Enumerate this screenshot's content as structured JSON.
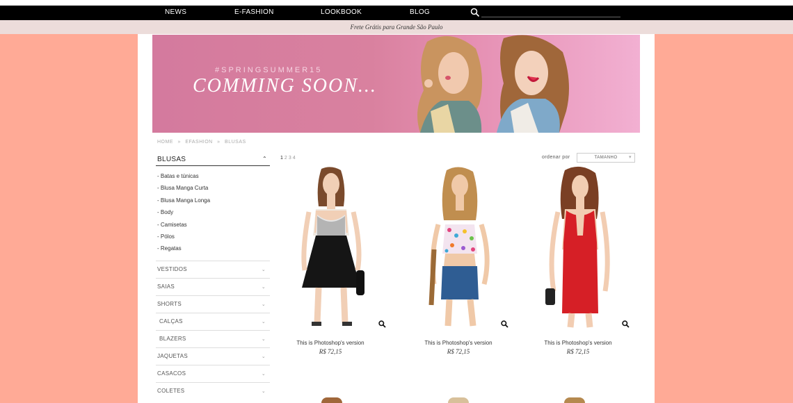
{
  "nav": {
    "items": [
      "NEWS",
      "E-FASHION",
      "LOOKBOOK",
      "BLOG"
    ],
    "search_placeholder": ""
  },
  "promo": {
    "text": "Frete Grátis para Grande São Paulo"
  },
  "banner": {
    "tag": "#SPRINGSUMMER15",
    "headline": "COMMING SOON..."
  },
  "breadcrumb": [
    "HOME",
    "»",
    "EFASHION",
    "»",
    "BLUSAS"
  ],
  "sidebar": {
    "current_category": "BLUSAS",
    "subcategories": [
      "- Batas e túnicas",
      "- Blusa Manga Curta",
      "- Blusa Manga Longa",
      "- Body",
      "- Camisetas",
      "- Pólos",
      "- Regatas"
    ],
    "categories": [
      "VESTIDOS",
      "SAIAS",
      "SHORTS",
      "CALÇAS",
      "BLAZERS",
      "JAQUETAS",
      "CASACOS",
      "COLETES"
    ]
  },
  "pagination": [
    "1",
    "2",
    "3",
    "4"
  ],
  "sort": {
    "label": "ordenar por",
    "selected": "TAMANHO"
  },
  "products": [
    {
      "name": "This is Photoshop's version",
      "price": "R$ 72,15"
    },
    {
      "name": "This is Photoshop's version",
      "price": "R$ 72,15"
    },
    {
      "name": "This is Photoshop's version",
      "price": "R$ 72,15"
    }
  ],
  "colors": {
    "background": "#ffaa96",
    "nav_bar": "#000000",
    "promo_bar": "#ecdcda",
    "banner_pink": "#d47a9e",
    "dress_red": "#d61f26"
  }
}
